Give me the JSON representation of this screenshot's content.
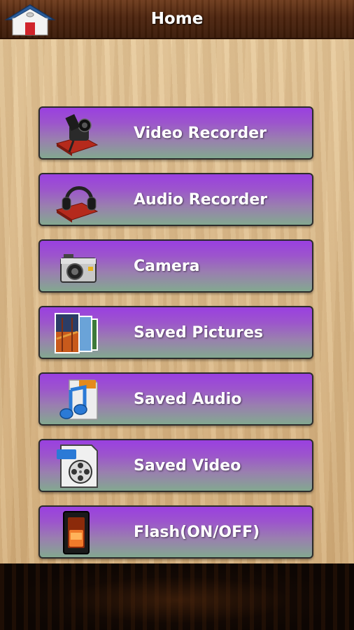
{
  "header": {
    "title": "Home",
    "home_icon": "house-icon"
  },
  "menu": [
    {
      "label": "Video Recorder",
      "icon": "video-recorder-icon"
    },
    {
      "label": "Audio Recorder",
      "icon": "headphones-icon"
    },
    {
      "label": "Camera",
      "icon": "camera-icon"
    },
    {
      "label": "Saved Pictures",
      "icon": "photos-icon"
    },
    {
      "label": "Saved Audio",
      "icon": "music-file-icon"
    },
    {
      "label": "Saved Video",
      "icon": "video-file-icon"
    },
    {
      "label": "Flash(ON/OFF)",
      "icon": "flash-switch-icon"
    }
  ],
  "colors": {
    "button_top": "#9a3fe0",
    "button_bottom": "#83a890",
    "header_bg": "#4d240e",
    "wood": "#ddbd8e"
  }
}
